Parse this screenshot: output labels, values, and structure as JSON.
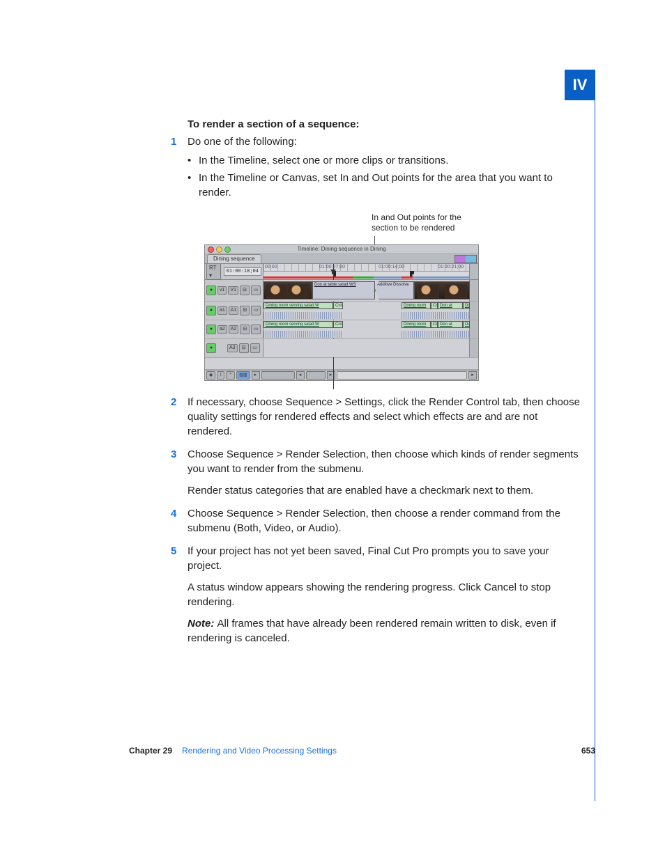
{
  "part_label": "IV",
  "heading": "To render a section of a sequence:",
  "steps": {
    "s1": {
      "num": "1",
      "text": "Do one of the following:",
      "bullets": [
        "In the Timeline, select one or more clips or transitions.",
        "In the Timeline or Canvas, set In and Out points for the area that you want to render."
      ]
    },
    "s2": {
      "num": "2",
      "text": "If necessary, choose Sequence > Settings, click the Render Control tab, then choose quality settings for rendered effects and select which effects are and are not rendered."
    },
    "s3": {
      "num": "3",
      "text": "Choose Sequence > Render Selection, then choose which kinds of render segments you want to render from the submenu.",
      "after": "Render status categories that are enabled have a checkmark next to them."
    },
    "s4": {
      "num": "4",
      "text": "Choose Sequence > Render Selection, then choose a render command from the submenu (Both, Video, or Audio)."
    },
    "s5": {
      "num": "5",
      "text": "If your project has not yet been saved, Final Cut Pro prompts you to save your project.",
      "after": "A status window appears showing the rendering progress. Click Cancel to stop rendering.",
      "note_label": "Note:  ",
      "note_body": "All frames that have already been rendered remain written to disk, even if rendering is canceled."
    }
  },
  "figure": {
    "callout": "In and Out points for the section to be rendered",
    "window_title": "Timeline: Dining sequence in Dining",
    "tab_name": "Dining sequence",
    "rt_button": "RT ▾",
    "current_tc": "01:00:18;04",
    "ruler_tcs": [
      "00:00",
      "01:00:07;00",
      "01:00:14;00",
      "01:00:21;00"
    ],
    "tracks": {
      "v1": {
        "src": "v1",
        "dst": "V1"
      },
      "a1": {
        "src": "a1",
        "dst": "A1"
      },
      "a2": {
        "src": "a2",
        "dst": "A2"
      },
      "a3": {
        "dst": "A3"
      }
    },
    "clips": {
      "v_ws_label": "Don at table salad WS",
      "v_dissolve": "Additive Dissolve",
      "a_serving": "Dining room serving salad W",
      "a_cross": "Cro",
      "a_dining": "Dining room",
      "a_don": "Don at table",
      "a_din": "Dini"
    }
  },
  "footer": {
    "chapter": "Chapter 29",
    "title": "Rendering and Video Processing Settings",
    "page": "653"
  }
}
